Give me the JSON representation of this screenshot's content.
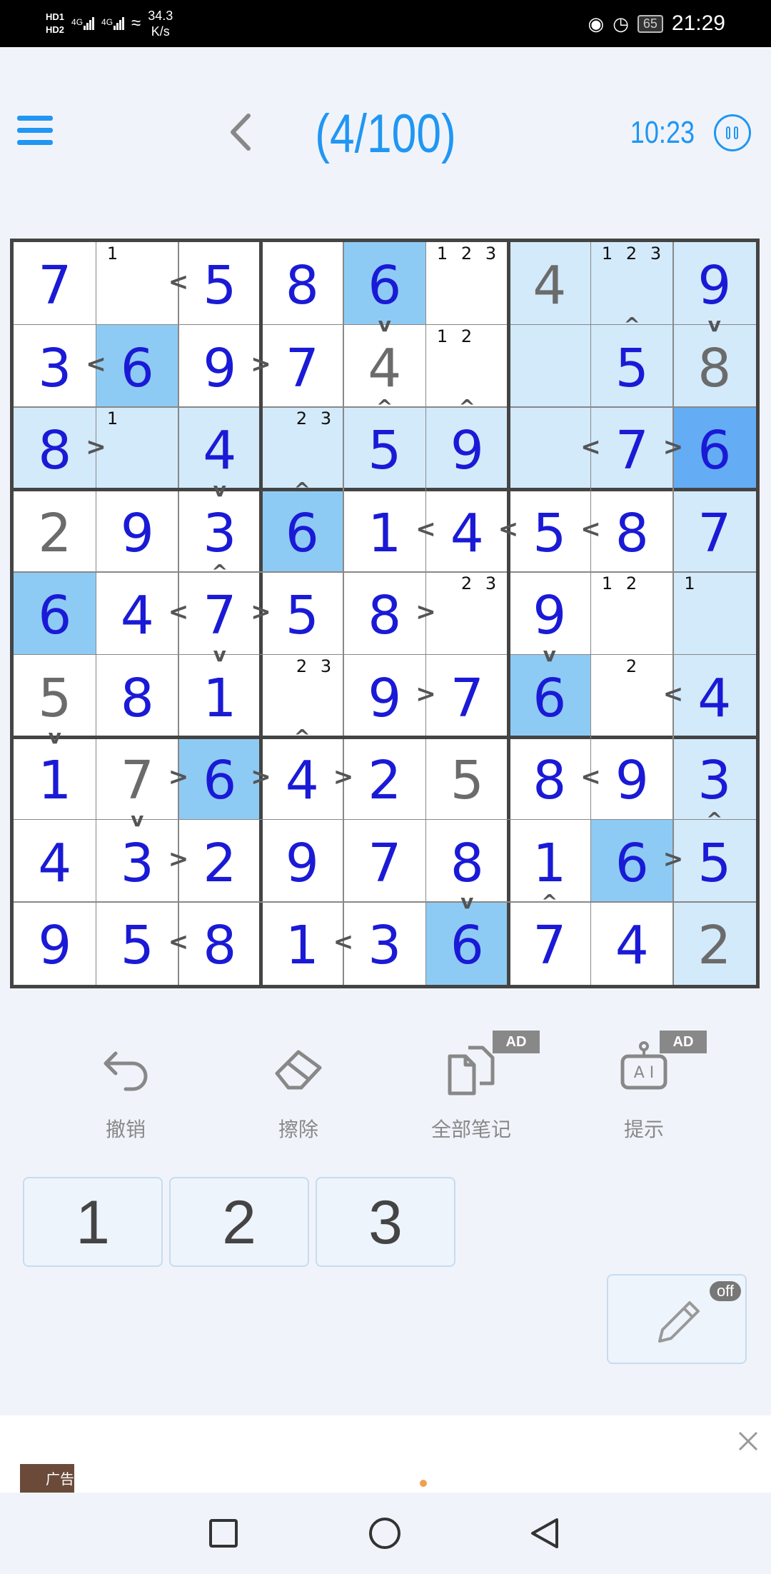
{
  "status_bar": {
    "hd1": "HD1",
    "hd2": "HD2",
    "net1": "4G",
    "net2": "4G",
    "speed_value": "34.3",
    "speed_unit": "K/s",
    "battery": "65",
    "time": "21:29"
  },
  "header": {
    "level": "(4/100)",
    "timer": "10:23"
  },
  "board": {
    "cells": [
      [
        {
          "v": "7",
          "c": "b",
          "bg": "w"
        },
        {
          "v": "",
          "n": [
            1
          ],
          "bg": "w"
        },
        {
          "v": "5",
          "c": "b",
          "bg": "w"
        },
        {
          "v": "8",
          "c": "b",
          "bg": "w"
        },
        {
          "v": "6",
          "c": "b",
          "bg": "s"
        },
        {
          "v": "",
          "n": [
            1,
            2,
            3
          ],
          "bg": "w"
        },
        {
          "v": "4",
          "c": "g",
          "bg": "l"
        },
        {
          "v": "",
          "n": [
            1,
            2,
            3
          ],
          "bg": "l"
        },
        {
          "v": "9",
          "c": "b",
          "bg": "l"
        }
      ],
      [
        {
          "v": "3",
          "c": "b",
          "bg": "w"
        },
        {
          "v": "6",
          "c": "b",
          "bg": "s"
        },
        {
          "v": "9",
          "c": "b",
          "bg": "w"
        },
        {
          "v": "7",
          "c": "b",
          "bg": "w"
        },
        {
          "v": "4",
          "c": "g",
          "bg": "w"
        },
        {
          "v": "",
          "n": [
            1,
            2
          ],
          "bg": "w"
        },
        {
          "v": "",
          "bg": "l"
        },
        {
          "v": "5",
          "c": "b",
          "bg": "l"
        },
        {
          "v": "8",
          "c": "g",
          "bg": "l"
        }
      ],
      [
        {
          "v": "8",
          "c": "b",
          "bg": "l"
        },
        {
          "v": "",
          "n": [
            1
          ],
          "bg": "l"
        },
        {
          "v": "4",
          "c": "b",
          "bg": "l"
        },
        {
          "v": "",
          "n": [
            2,
            3
          ],
          "bg": "l"
        },
        {
          "v": "5",
          "c": "b",
          "bg": "l"
        },
        {
          "v": "9",
          "c": "b",
          "bg": "l"
        },
        {
          "v": "",
          "bg": "l"
        },
        {
          "v": "7",
          "c": "b",
          "bg": "l"
        },
        {
          "v": "6",
          "c": "b",
          "bg": "d"
        }
      ],
      [
        {
          "v": "2",
          "c": "g",
          "bg": "w"
        },
        {
          "v": "9",
          "c": "b",
          "bg": "w"
        },
        {
          "v": "3",
          "c": "b",
          "bg": "w"
        },
        {
          "v": "6",
          "c": "b",
          "bg": "s"
        },
        {
          "v": "1",
          "c": "b",
          "bg": "w"
        },
        {
          "v": "4",
          "c": "b",
          "bg": "w"
        },
        {
          "v": "5",
          "c": "b",
          "bg": "w"
        },
        {
          "v": "8",
          "c": "b",
          "bg": "w"
        },
        {
          "v": "7",
          "c": "b",
          "bg": "l"
        }
      ],
      [
        {
          "v": "6",
          "c": "b",
          "bg": "s"
        },
        {
          "v": "4",
          "c": "b",
          "bg": "w"
        },
        {
          "v": "7",
          "c": "b",
          "bg": "w"
        },
        {
          "v": "5",
          "c": "b",
          "bg": "w"
        },
        {
          "v": "8",
          "c": "b",
          "bg": "w"
        },
        {
          "v": "",
          "n": [
            2,
            3
          ],
          "bg": "w"
        },
        {
          "v": "9",
          "c": "b",
          "bg": "w"
        },
        {
          "v": "",
          "n": [
            1,
            2
          ],
          "bg": "w"
        },
        {
          "v": "",
          "n": [
            1
          ],
          "bg": "l"
        }
      ],
      [
        {
          "v": "5",
          "c": "g",
          "bg": "w"
        },
        {
          "v": "8",
          "c": "b",
          "bg": "w"
        },
        {
          "v": "1",
          "c": "b",
          "bg": "w"
        },
        {
          "v": "",
          "n": [
            2,
            3
          ],
          "bg": "w"
        },
        {
          "v": "9",
          "c": "b",
          "bg": "w"
        },
        {
          "v": "7",
          "c": "b",
          "bg": "w"
        },
        {
          "v": "6",
          "c": "b",
          "bg": "s"
        },
        {
          "v": "",
          "n": [
            2
          ],
          "bg": "w"
        },
        {
          "v": "4",
          "c": "b",
          "bg": "l"
        }
      ],
      [
        {
          "v": "1",
          "c": "b",
          "bg": "w"
        },
        {
          "v": "7",
          "c": "g",
          "bg": "w"
        },
        {
          "v": "6",
          "c": "b",
          "bg": "s"
        },
        {
          "v": "4",
          "c": "b",
          "bg": "w"
        },
        {
          "v": "2",
          "c": "b",
          "bg": "w"
        },
        {
          "v": "5",
          "c": "g",
          "bg": "w"
        },
        {
          "v": "8",
          "c": "b",
          "bg": "w"
        },
        {
          "v": "9",
          "c": "b",
          "bg": "w"
        },
        {
          "v": "3",
          "c": "b",
          "bg": "l"
        }
      ],
      [
        {
          "v": "4",
          "c": "b",
          "bg": "w"
        },
        {
          "v": "3",
          "c": "b",
          "bg": "w"
        },
        {
          "v": "2",
          "c": "b",
          "bg": "w"
        },
        {
          "v": "9",
          "c": "b",
          "bg": "w"
        },
        {
          "v": "7",
          "c": "b",
          "bg": "w"
        },
        {
          "v": "8",
          "c": "b",
          "bg": "w"
        },
        {
          "v": "1",
          "c": "b",
          "bg": "w"
        },
        {
          "v": "6",
          "c": "b",
          "bg": "s"
        },
        {
          "v": "5",
          "c": "b",
          "bg": "l"
        }
      ],
      [
        {
          "v": "9",
          "c": "b",
          "bg": "w"
        },
        {
          "v": "5",
          "c": "b",
          "bg": "w"
        },
        {
          "v": "8",
          "c": "b",
          "bg": "w"
        },
        {
          "v": "1",
          "c": "b",
          "bg": "w"
        },
        {
          "v": "3",
          "c": "b",
          "bg": "w"
        },
        {
          "v": "6",
          "c": "b",
          "bg": "s"
        },
        {
          "v": "7",
          "c": "b",
          "bg": "w"
        },
        {
          "v": "4",
          "c": "b",
          "bg": "w"
        },
        {
          "v": "2",
          "c": "g",
          "bg": "l"
        }
      ]
    ],
    "h_ineq": [
      {
        "r": 0,
        "c": 1,
        "s": "<"
      },
      {
        "r": 1,
        "c": 0,
        "s": "<"
      },
      {
        "r": 1,
        "c": 2,
        "s": ">"
      },
      {
        "r": 2,
        "c": 0,
        "s": ">"
      },
      {
        "r": 2,
        "c": 6,
        "s": "<"
      },
      {
        "r": 2,
        "c": 7,
        "s": ">"
      },
      {
        "r": 3,
        "c": 4,
        "s": "<"
      },
      {
        "r": 3,
        "c": 5,
        "s": "<"
      },
      {
        "r": 3,
        "c": 6,
        "s": "<"
      },
      {
        "r": 4,
        "c": 1,
        "s": "<"
      },
      {
        "r": 4,
        "c": 2,
        "s": ">"
      },
      {
        "r": 4,
        "c": 4,
        "s": ">"
      },
      {
        "r": 5,
        "c": 4,
        "s": ">"
      },
      {
        "r": 5,
        "c": 7,
        "s": "<"
      },
      {
        "r": 6,
        "c": 1,
        "s": ">"
      },
      {
        "r": 6,
        "c": 2,
        "s": ">"
      },
      {
        "r": 6,
        "c": 3,
        "s": ">"
      },
      {
        "r": 6,
        "c": 6,
        "s": "<"
      },
      {
        "r": 7,
        "c": 1,
        "s": ">"
      },
      {
        "r": 7,
        "c": 7,
        "s": ">"
      },
      {
        "r": 8,
        "c": 1,
        "s": "<"
      },
      {
        "r": 8,
        "c": 3,
        "s": "<"
      }
    ],
    "v_ineq": [
      {
        "r": 0,
        "c": 4,
        "s": "v"
      },
      {
        "r": 0,
        "c": 7,
        "s": "^"
      },
      {
        "r": 0,
        "c": 8,
        "s": "v"
      },
      {
        "r": 1,
        "c": 4,
        "s": "^"
      },
      {
        "r": 1,
        "c": 5,
        "s": "^"
      },
      {
        "r": 2,
        "c": 2,
        "s": "v"
      },
      {
        "r": 2,
        "c": 3,
        "s": "^"
      },
      {
        "r": 3,
        "c": 2,
        "s": "^"
      },
      {
        "r": 4,
        "c": 2,
        "s": "v"
      },
      {
        "r": 4,
        "c": 6,
        "s": "v"
      },
      {
        "r": 5,
        "c": 0,
        "s": "v"
      },
      {
        "r": 5,
        "c": 3,
        "s": "^"
      },
      {
        "r": 6,
        "c": 1,
        "s": "v"
      },
      {
        "r": 6,
        "c": 8,
        "s": "^"
      },
      {
        "r": 7,
        "c": 5,
        "s": "v"
      },
      {
        "r": 7,
        "c": 6,
        "s": "^"
      }
    ]
  },
  "tools": {
    "undo": "撤销",
    "erase": "擦除",
    "all_notes": "全部笔记",
    "hint": "提示",
    "ad_badge": "AD"
  },
  "candidates": [
    "1",
    "2",
    "3"
  ],
  "pencil": {
    "state": "off"
  },
  "ad": {
    "label": "广告"
  },
  "colors": {
    "accent": "#2196f3",
    "digit_blue": "#1a1ad6",
    "digit_gray": "#6b6b6b",
    "cell_white": "#ffffff",
    "cell_light": "#d3eafb",
    "cell_same": "#8ecbf4",
    "cell_selected": "#64adf4"
  }
}
